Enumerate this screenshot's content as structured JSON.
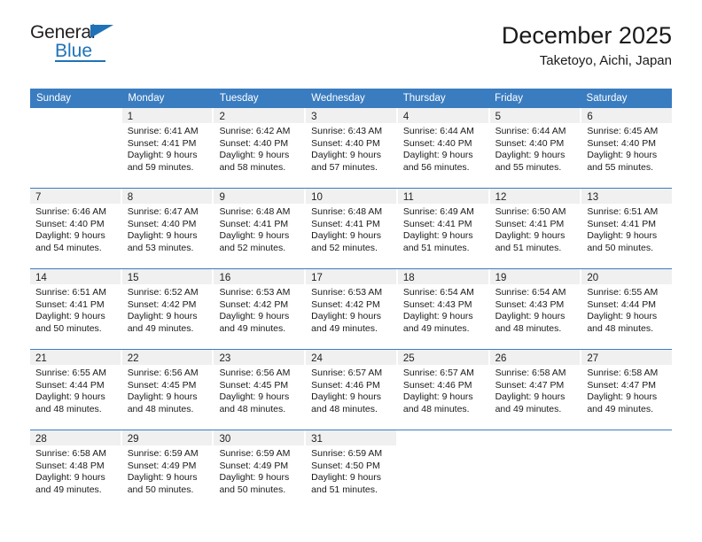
{
  "brand": {
    "name_top": "General",
    "name_bottom": "Blue",
    "triangle_icon": "blue-triangle-icon",
    "color_blue": "#1f72b8",
    "color_dark": "#231f20"
  },
  "header": {
    "title": "December 2025",
    "subtitle": "Taketoyo, Aichi, Japan",
    "accent_color": "#3a7cc0"
  },
  "calendar": {
    "weekday_headers": [
      "Sunday",
      "Monday",
      "Tuesday",
      "Wednesday",
      "Thursday",
      "Friday",
      "Saturday"
    ],
    "weeks": [
      [
        {
          "day": "",
          "lines": []
        },
        {
          "day": "1",
          "lines": [
            "Sunrise: 6:41 AM",
            "Sunset: 4:41 PM",
            "Daylight: 9 hours",
            "and 59 minutes."
          ]
        },
        {
          "day": "2",
          "lines": [
            "Sunrise: 6:42 AM",
            "Sunset: 4:40 PM",
            "Daylight: 9 hours",
            "and 58 minutes."
          ]
        },
        {
          "day": "3",
          "lines": [
            "Sunrise: 6:43 AM",
            "Sunset: 4:40 PM",
            "Daylight: 9 hours",
            "and 57 minutes."
          ]
        },
        {
          "day": "4",
          "lines": [
            "Sunrise: 6:44 AM",
            "Sunset: 4:40 PM",
            "Daylight: 9 hours",
            "and 56 minutes."
          ]
        },
        {
          "day": "5",
          "lines": [
            "Sunrise: 6:44 AM",
            "Sunset: 4:40 PM",
            "Daylight: 9 hours",
            "and 55 minutes."
          ]
        },
        {
          "day": "6",
          "lines": [
            "Sunrise: 6:45 AM",
            "Sunset: 4:40 PM",
            "Daylight: 9 hours",
            "and 55 minutes."
          ]
        }
      ],
      [
        {
          "day": "7",
          "lines": [
            "Sunrise: 6:46 AM",
            "Sunset: 4:40 PM",
            "Daylight: 9 hours",
            "and 54 minutes."
          ]
        },
        {
          "day": "8",
          "lines": [
            "Sunrise: 6:47 AM",
            "Sunset: 4:40 PM",
            "Daylight: 9 hours",
            "and 53 minutes."
          ]
        },
        {
          "day": "9",
          "lines": [
            "Sunrise: 6:48 AM",
            "Sunset: 4:41 PM",
            "Daylight: 9 hours",
            "and 52 minutes."
          ]
        },
        {
          "day": "10",
          "lines": [
            "Sunrise: 6:48 AM",
            "Sunset: 4:41 PM",
            "Daylight: 9 hours",
            "and 52 minutes."
          ]
        },
        {
          "day": "11",
          "lines": [
            "Sunrise: 6:49 AM",
            "Sunset: 4:41 PM",
            "Daylight: 9 hours",
            "and 51 minutes."
          ]
        },
        {
          "day": "12",
          "lines": [
            "Sunrise: 6:50 AM",
            "Sunset: 4:41 PM",
            "Daylight: 9 hours",
            "and 51 minutes."
          ]
        },
        {
          "day": "13",
          "lines": [
            "Sunrise: 6:51 AM",
            "Sunset: 4:41 PM",
            "Daylight: 9 hours",
            "and 50 minutes."
          ]
        }
      ],
      [
        {
          "day": "14",
          "lines": [
            "Sunrise: 6:51 AM",
            "Sunset: 4:41 PM",
            "Daylight: 9 hours",
            "and 50 minutes."
          ]
        },
        {
          "day": "15",
          "lines": [
            "Sunrise: 6:52 AM",
            "Sunset: 4:42 PM",
            "Daylight: 9 hours",
            "and 49 minutes."
          ]
        },
        {
          "day": "16",
          "lines": [
            "Sunrise: 6:53 AM",
            "Sunset: 4:42 PM",
            "Daylight: 9 hours",
            "and 49 minutes."
          ]
        },
        {
          "day": "17",
          "lines": [
            "Sunrise: 6:53 AM",
            "Sunset: 4:42 PM",
            "Daylight: 9 hours",
            "and 49 minutes."
          ]
        },
        {
          "day": "18",
          "lines": [
            "Sunrise: 6:54 AM",
            "Sunset: 4:43 PM",
            "Daylight: 9 hours",
            "and 49 minutes."
          ]
        },
        {
          "day": "19",
          "lines": [
            "Sunrise: 6:54 AM",
            "Sunset: 4:43 PM",
            "Daylight: 9 hours",
            "and 48 minutes."
          ]
        },
        {
          "day": "20",
          "lines": [
            "Sunrise: 6:55 AM",
            "Sunset: 4:44 PM",
            "Daylight: 9 hours",
            "and 48 minutes."
          ]
        }
      ],
      [
        {
          "day": "21",
          "lines": [
            "Sunrise: 6:55 AM",
            "Sunset: 4:44 PM",
            "Daylight: 9 hours",
            "and 48 minutes."
          ]
        },
        {
          "day": "22",
          "lines": [
            "Sunrise: 6:56 AM",
            "Sunset: 4:45 PM",
            "Daylight: 9 hours",
            "and 48 minutes."
          ]
        },
        {
          "day": "23",
          "lines": [
            "Sunrise: 6:56 AM",
            "Sunset: 4:45 PM",
            "Daylight: 9 hours",
            "and 48 minutes."
          ]
        },
        {
          "day": "24",
          "lines": [
            "Sunrise: 6:57 AM",
            "Sunset: 4:46 PM",
            "Daylight: 9 hours",
            "and 48 minutes."
          ]
        },
        {
          "day": "25",
          "lines": [
            "Sunrise: 6:57 AM",
            "Sunset: 4:46 PM",
            "Daylight: 9 hours",
            "and 48 minutes."
          ]
        },
        {
          "day": "26",
          "lines": [
            "Sunrise: 6:58 AM",
            "Sunset: 4:47 PM",
            "Daylight: 9 hours",
            "and 49 minutes."
          ]
        },
        {
          "day": "27",
          "lines": [
            "Sunrise: 6:58 AM",
            "Sunset: 4:47 PM",
            "Daylight: 9 hours",
            "and 49 minutes."
          ]
        }
      ],
      [
        {
          "day": "28",
          "lines": [
            "Sunrise: 6:58 AM",
            "Sunset: 4:48 PM",
            "Daylight: 9 hours",
            "and 49 minutes."
          ]
        },
        {
          "day": "29",
          "lines": [
            "Sunrise: 6:59 AM",
            "Sunset: 4:49 PM",
            "Daylight: 9 hours",
            "and 50 minutes."
          ]
        },
        {
          "day": "30",
          "lines": [
            "Sunrise: 6:59 AM",
            "Sunset: 4:49 PM",
            "Daylight: 9 hours",
            "and 50 minutes."
          ]
        },
        {
          "day": "31",
          "lines": [
            "Sunrise: 6:59 AM",
            "Sunset: 4:50 PM",
            "Daylight: 9 hours",
            "and 51 minutes."
          ]
        },
        {
          "day": "",
          "lines": []
        },
        {
          "day": "",
          "lines": []
        },
        {
          "day": "",
          "lines": []
        }
      ]
    ]
  }
}
